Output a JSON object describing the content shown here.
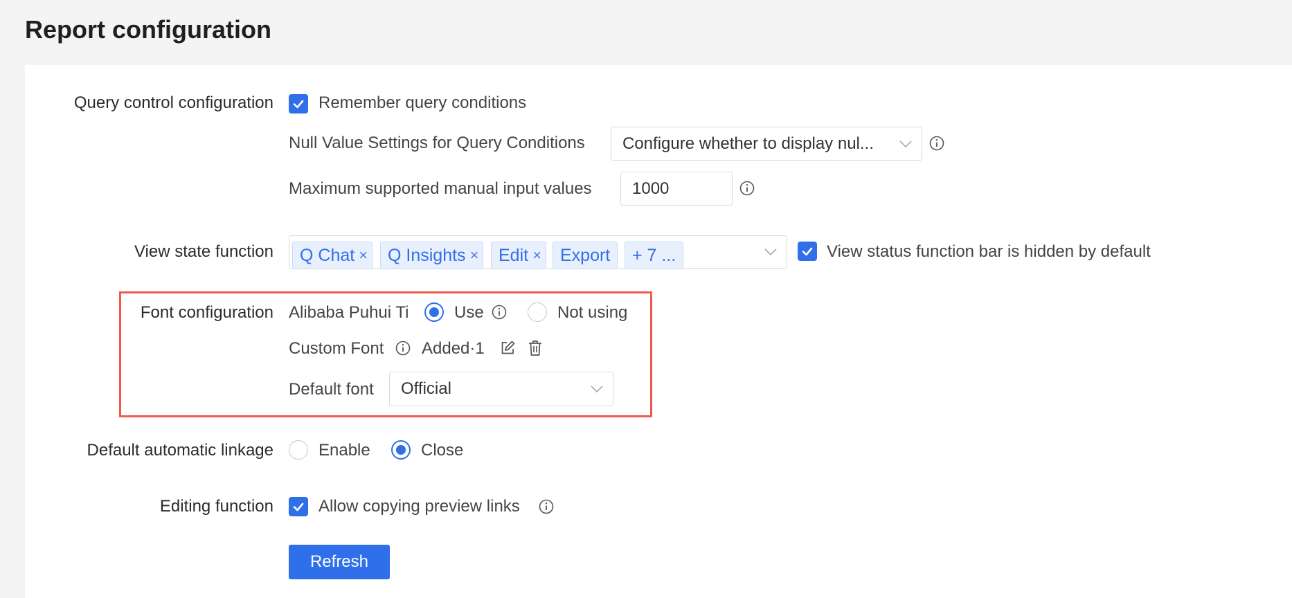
{
  "page": {
    "title": "Report configuration"
  },
  "query_control": {
    "label": "Query control configuration",
    "remember_label": "Remember query conditions",
    "remember_checked": true,
    "null_value_label": "Null Value Settings for Query Conditions",
    "null_value_selected": "Configure whether to display nul...",
    "max_input_label": "Maximum supported manual input values",
    "max_input_value": "1000"
  },
  "view_state": {
    "label": "View state function",
    "tags": [
      "Q Chat",
      "Q Insights",
      "Edit",
      "Export"
    ],
    "more_tag": "+ 7 ...",
    "hidden_default_label": "View status function bar is hidden by default",
    "hidden_default_checked": true
  },
  "font_config": {
    "label": "Font configuration",
    "alibaba_label": "Alibaba Puhui Ti",
    "use_label": "Use",
    "not_using_label": "Not using",
    "selected": "Use",
    "custom_font_label": "Custom Font",
    "added_text": "Added·1",
    "default_font_label": "Default font",
    "default_font_value": "Official"
  },
  "linkage": {
    "label": "Default automatic linkage",
    "enable_label": "Enable",
    "close_label": "Close",
    "selected": "Close"
  },
  "editing": {
    "label": "Editing function",
    "allow_copy_label": "Allow copying preview links",
    "allow_copy_checked": true
  },
  "actions": {
    "refresh_label": "Refresh"
  },
  "colors": {
    "primary": "#2f6fea",
    "highlight_border": "#ef5a4c",
    "tag_bg": "#e9f0fd"
  },
  "icons": [
    "check-icon",
    "chevron-down-icon",
    "info-icon",
    "close-icon",
    "edit-icon",
    "trash-icon"
  ]
}
